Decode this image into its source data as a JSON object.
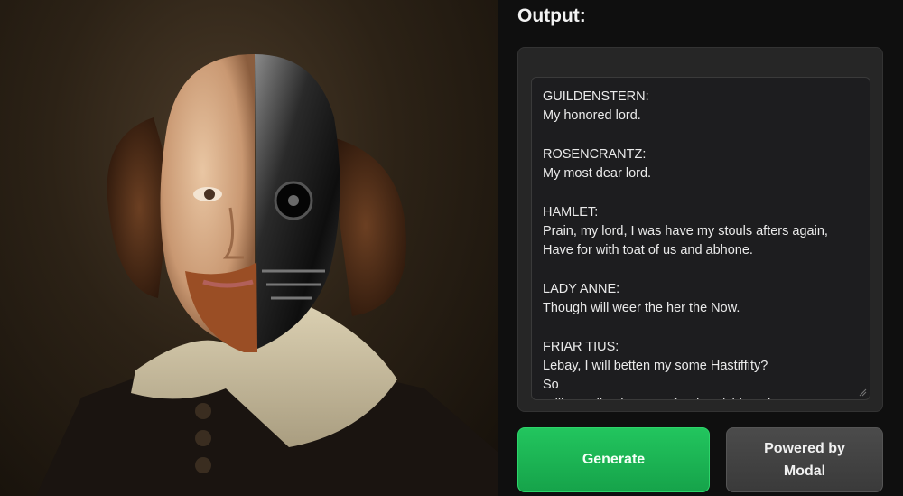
{
  "output": {
    "title": "Output:",
    "text": "GUILDENSTERN:\nMy honored lord.\n\nROSENCRANTZ:\nMy most dear lord.\n\nHAMLET:\nPrain, my lord, I was have my stouls afters again,\nHave for with toat of us and abhone.\n\nLADY ANNE:\nThough will weer the her the Now.\n\nFRIAR TIUS:\nLebay, I will betten my some Hastiffity?\nSo\nWill vour lite the way of orderadshin. I thy"
  },
  "buttons": {
    "generate_label": "Generate",
    "modal_label": "Powered by Modal"
  },
  "colors": {
    "generate": "#22c55e",
    "background": "#0f0f0f",
    "card": "#262626"
  }
}
